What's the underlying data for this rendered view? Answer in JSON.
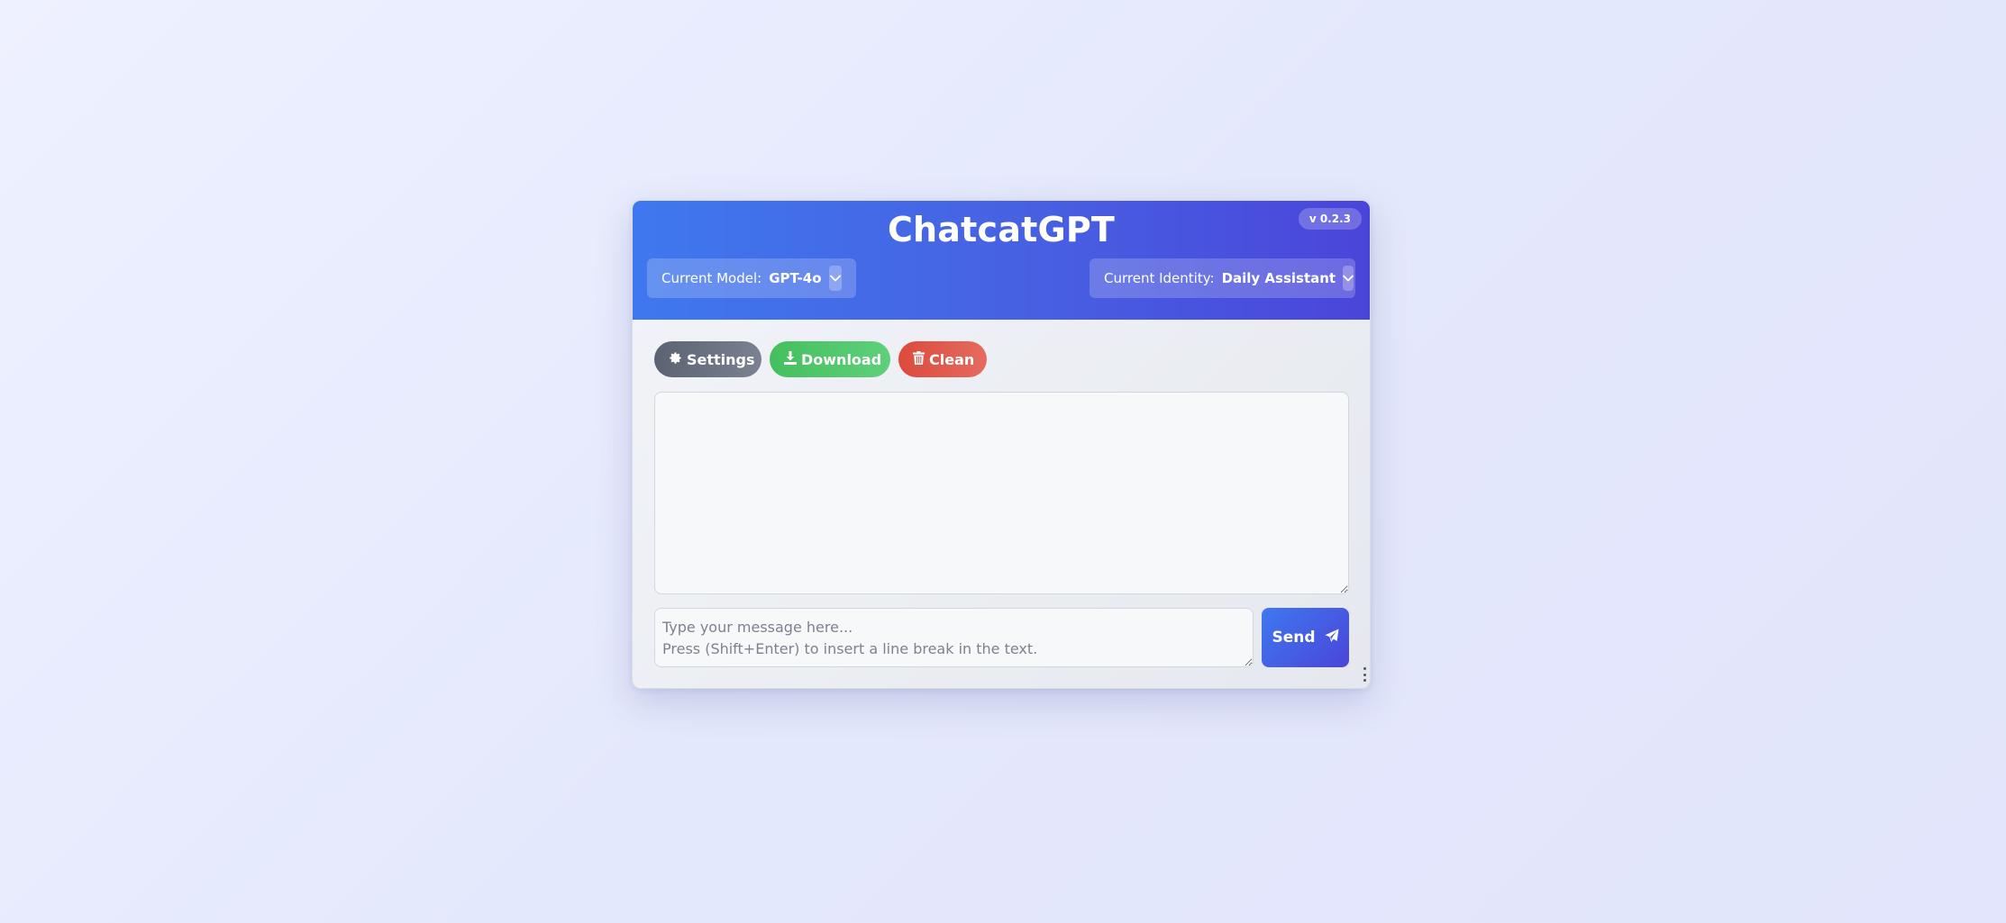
{
  "app": {
    "title": "ChatcatGPT",
    "version": "v  0.2.3"
  },
  "header": {
    "model_label": "Current Model:",
    "model_value": "GPT-4o",
    "identity_label": "Current Identity:",
    "identity_value": "Daily Assistant"
  },
  "toolbar": {
    "settings_label": "Settings",
    "download_label": "Download",
    "clean_label": "Clean"
  },
  "input": {
    "placeholder": "Type your message here...\nPress (Shift+Enter) to insert a line break in the text.",
    "value": ""
  },
  "send": {
    "label": "Send"
  },
  "icons": {
    "settings": "gear-icon",
    "download": "download-icon",
    "clean": "trash-icon",
    "send": "paper-plane-icon",
    "dropdown": "chevron-down-icon",
    "more": "vertical-dots-icon"
  },
  "colors": {
    "header_start": "#3f78ee",
    "header_end": "#4a45da",
    "settings": "#5b6271",
    "download": "#45bf5e",
    "clean": "#dc4a3c"
  }
}
